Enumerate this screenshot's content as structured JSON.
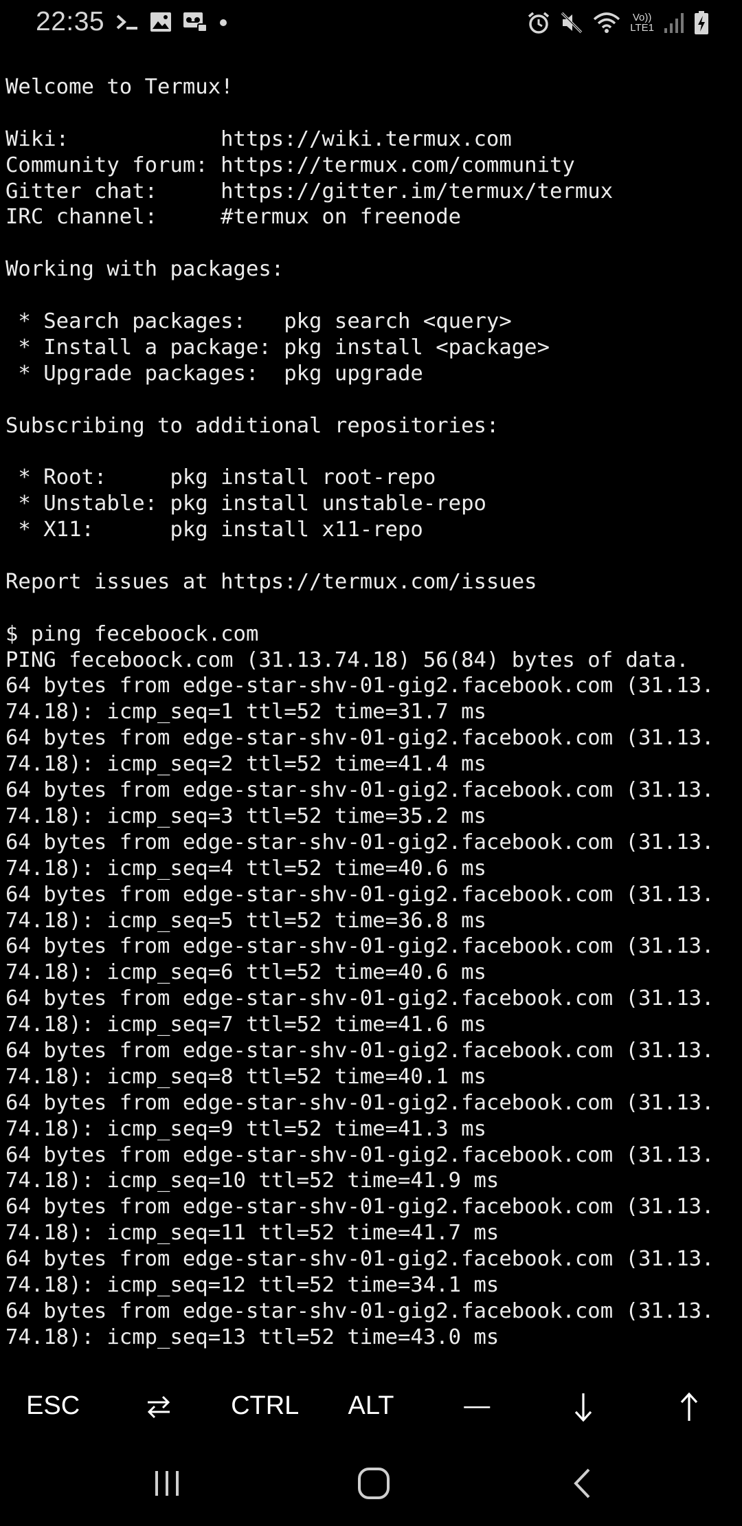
{
  "status_bar": {
    "time": "22:35",
    "network_label_top": "Vo))",
    "network_label_bottom": "LTE1",
    "icons_left": [
      "terminal-icon",
      "image-icon",
      "voicemail-icon",
      "dot-icon"
    ],
    "icons_right": [
      "alarm-icon",
      "mute-icon",
      "wifi-icon",
      "signal-icon",
      "battery-charging-icon"
    ]
  },
  "terminal": {
    "lines": [
      "Welcome to Termux!",
      "",
      "Wiki:            https://wiki.termux.com",
      "Community forum: https://termux.com/community",
      "Gitter chat:     https://gitter.im/termux/termux",
      "IRC channel:     #termux on freenode",
      "",
      "Working with packages:",
      "",
      " * Search packages:   pkg search <query>",
      " * Install a package: pkg install <package>",
      " * Upgrade packages:  pkg upgrade",
      "",
      "Subscribing to additional repositories:",
      "",
      " * Root:     pkg install root-repo",
      " * Unstable: pkg install unstable-repo",
      " * X11:      pkg install x11-repo",
      "",
      "Report issues at https://termux.com/issues",
      "",
      "$ ping feceboock.com",
      "PING feceboock.com (31.13.74.18) 56(84) bytes of data.",
      "64 bytes from edge-star-shv-01-gig2.facebook.com (31.13.",
      "74.18): icmp_seq=1 ttl=52 time=31.7 ms",
      "64 bytes from edge-star-shv-01-gig2.facebook.com (31.13.",
      "74.18): icmp_seq=2 ttl=52 time=41.4 ms",
      "64 bytes from edge-star-shv-01-gig2.facebook.com (31.13.",
      "74.18): icmp_seq=3 ttl=52 time=35.2 ms",
      "64 bytes from edge-star-shv-01-gig2.facebook.com (31.13.",
      "74.18): icmp_seq=4 ttl=52 time=40.6 ms",
      "64 bytes from edge-star-shv-01-gig2.facebook.com (31.13.",
      "74.18): icmp_seq=5 ttl=52 time=36.8 ms",
      "64 bytes from edge-star-shv-01-gig2.facebook.com (31.13.",
      "74.18): icmp_seq=6 ttl=52 time=40.6 ms",
      "64 bytes from edge-star-shv-01-gig2.facebook.com (31.13.",
      "74.18): icmp_seq=7 ttl=52 time=41.6 ms",
      "64 bytes from edge-star-shv-01-gig2.facebook.com (31.13.",
      "74.18): icmp_seq=8 ttl=52 time=40.1 ms",
      "64 bytes from edge-star-shv-01-gig2.facebook.com (31.13.",
      "74.18): icmp_seq=9 ttl=52 time=41.3 ms",
      "64 bytes from edge-star-shv-01-gig2.facebook.com (31.13.",
      "74.18): icmp_seq=10 ttl=52 time=41.9 ms",
      "64 bytes from edge-star-shv-01-gig2.facebook.com (31.13.",
      "74.18): icmp_seq=11 ttl=52 time=41.7 ms",
      "64 bytes from edge-star-shv-01-gig2.facebook.com (31.13.",
      "74.18): icmp_seq=12 ttl=52 time=34.1 ms",
      "64 bytes from edge-star-shv-01-gig2.facebook.com (31.13.",
      "74.18): icmp_seq=13 ttl=52 time=43.0 ms"
    ]
  },
  "extra_keys": {
    "esc": "ESC",
    "tab_icon": "tab-arrows-icon",
    "ctrl": "CTRL",
    "alt": "ALT",
    "dash": "—",
    "down_icon": "arrow-down-icon",
    "up_icon": "arrow-up-icon"
  },
  "nav_bar": {
    "icons": [
      "recents-icon",
      "home-icon",
      "back-icon"
    ]
  },
  "colors": {
    "background": "#000000",
    "text": "#ececec",
    "status_text": "#d6d6d6"
  }
}
